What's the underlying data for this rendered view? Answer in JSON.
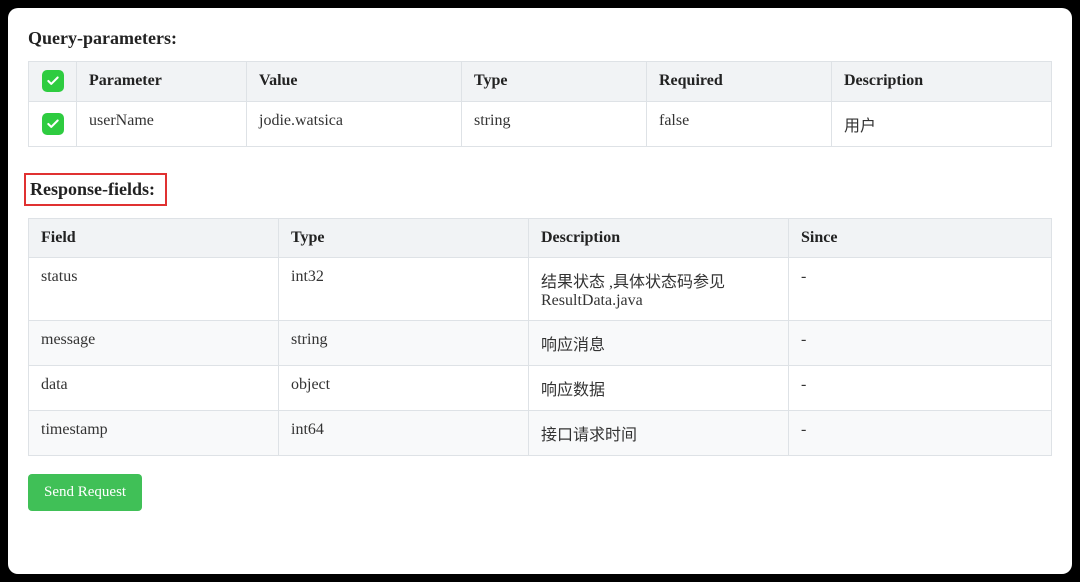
{
  "query_params": {
    "title": "Query-parameters:",
    "headers": [
      "Parameter",
      "Value",
      "Type",
      "Required",
      "Description"
    ],
    "rows": [
      {
        "checked": true,
        "parameter": "userName",
        "value": "jodie.watsica",
        "type": "string",
        "required": "false",
        "description": "用户"
      }
    ]
  },
  "response_fields": {
    "title": "Response-fields:",
    "headers": [
      "Field",
      "Type",
      "Description",
      "Since"
    ],
    "rows": [
      {
        "field": "status",
        "type": "int32",
        "description": "结果状态 ,具体状态码参见 ResultData.java",
        "since": "-"
      },
      {
        "field": "message",
        "type": "string",
        "description": "响应消息",
        "since": "-"
      },
      {
        "field": "data",
        "type": "object",
        "description": "响应数据",
        "since": "-"
      },
      {
        "field": "timestamp",
        "type": "int64",
        "description": "接口请求时间",
        "since": "-"
      }
    ]
  },
  "actions": {
    "send_request": "Send Request"
  }
}
